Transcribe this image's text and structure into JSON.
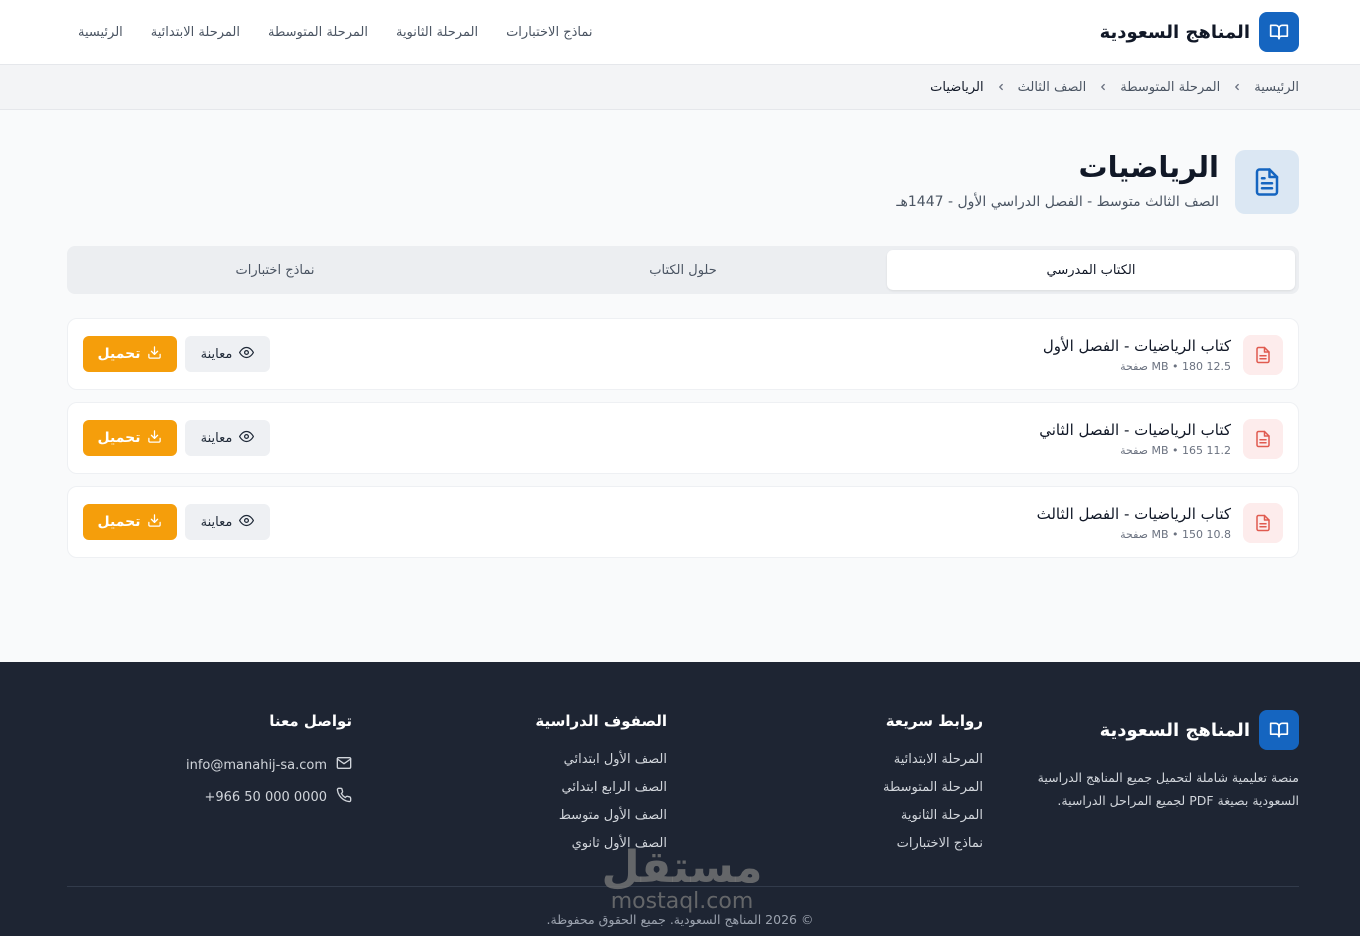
{
  "header": {
    "brand_name": "المناهج السعودية",
    "nav": [
      "الرئيسية",
      "المرحلة الابتدائية",
      "المرحلة المتوسطة",
      "المرحلة الثانوية",
      "نماذج الاختبارات"
    ]
  },
  "breadcrumb": [
    "الرئيسية",
    "المرحلة المتوسطة",
    "الصف الثالث",
    "الرياضيات"
  ],
  "page": {
    "title": "الرياضيات",
    "subtitle": "الصف الثالث متوسط - الفصل الدراسي الأول - 1447هـ"
  },
  "tabs": [
    {
      "label": "الكتاب المدرسي",
      "active": true
    },
    {
      "label": "حلول الكتاب",
      "active": false
    },
    {
      "label": "نماذج اختبارات",
      "active": false
    }
  ],
  "files": [
    {
      "title": "كتاب الرياضيات - الفصل الأول",
      "meta": "12.5 MB • 180 صفحة",
      "view_label": "معاينة",
      "download_label": "تحميل"
    },
    {
      "title": "كتاب الرياضيات - الفصل الثاني",
      "meta": "11.2 MB • 165 صفحة",
      "view_label": "معاينة",
      "download_label": "تحميل"
    },
    {
      "title": "كتاب الرياضيات - الفصل الثالث",
      "meta": "10.8 MB • 150 صفحة",
      "view_label": "معاينة",
      "download_label": "تحميل"
    }
  ],
  "footer": {
    "brand_name": "المناهج السعودية",
    "description": "منصة تعليمية شاملة لتحميل جميع المناهج الدراسية السعودية بصيغة PDF لجميع المراحل الدراسية.",
    "quick_links": {
      "title": "روابط سريعة",
      "items": [
        "المرحلة الابتدائية",
        "المرحلة المتوسطة",
        "المرحلة الثانوية",
        "نماذج الاختبارات"
      ]
    },
    "grades": {
      "title": "الصفوف الدراسية",
      "items": [
        "الصف الأول ابتدائي",
        "الصف الرابع ابتدائي",
        "الصف الأول متوسط",
        "الصف الأول ثانوي"
      ]
    },
    "contact": {
      "title": "تواصل معنا",
      "email": "info@manahij-sa.com",
      "phone": "+966 50 000 0000"
    },
    "copyright": "© 2026 المناهج السعودية. جميع الحقوق محفوظة."
  },
  "watermark": {
    "arabic": "مستقل",
    "latin": "mostaql.com"
  },
  "colors": {
    "primary": "#1565c0",
    "accent": "#f59e0b",
    "footer_bg": "#1e2533",
    "pdf_red": "#e05a4f"
  },
  "icons": {
    "brand": "open-book-icon",
    "page": "document-icon",
    "file": "pdf-file-icon",
    "view": "eye-icon",
    "download": "download-icon",
    "email": "mail-icon",
    "phone": "phone-icon",
    "breadcrumb_sep": "chevron-left-icon"
  }
}
